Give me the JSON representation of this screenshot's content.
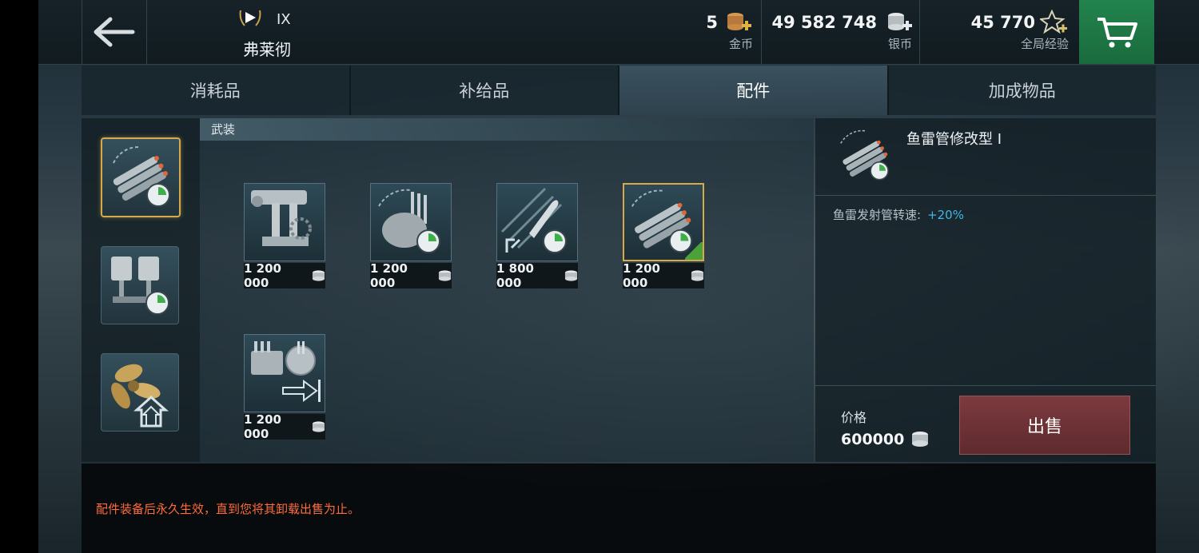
{
  "header": {
    "back_icon": "arrow-left-icon",
    "tier": "IX",
    "ship_name": "弗莱彻",
    "resources": [
      {
        "value": "5",
        "label": "金币",
        "icon": "gold-coins-icon"
      },
      {
        "value": "49 582 748",
        "label": "银币",
        "icon": "silver-coins-icon"
      },
      {
        "value": "45 770",
        "label": "全局经验",
        "icon": "star-xp-icon"
      }
    ],
    "cart_icon": "cart-icon"
  },
  "tabs": [
    {
      "label": "消耗品",
      "active": false
    },
    {
      "label": "补给品",
      "active": false
    },
    {
      "label": "配件",
      "active": true
    },
    {
      "label": "加成物品",
      "active": false
    }
  ],
  "categories": [
    {
      "name": "torpedo-category",
      "selected": true
    },
    {
      "name": "engine-category",
      "selected": false
    },
    {
      "name": "propeller-category",
      "selected": false
    }
  ],
  "section": {
    "title": "武装"
  },
  "items": [
    {
      "name": "main-battery-mod",
      "price": "1 200 000",
      "selected": false
    },
    {
      "name": "turret-rotation-mod",
      "price": "1 200 000",
      "selected": false
    },
    {
      "name": "gun-reload-mod",
      "price": "1 800 000",
      "selected": false
    },
    {
      "name": "torpedo-tube-mod",
      "price": "1 200 000",
      "selected": true
    },
    {
      "name": "secondary-battery-mod",
      "price": "1 200 000",
      "selected": false
    }
  ],
  "detail": {
    "name": "鱼雷管修改型 I",
    "stat_label": "鱼雷发射管转速:",
    "stat_bonus": "+20%",
    "price_label": "价格",
    "price_value": "600000",
    "sell_label": "出售"
  },
  "notice": "配件装备后永久生效，直到您将其卸载出售为止。",
  "colors": {
    "accent_gold": "#d6a94a",
    "cart_green": "#22834d",
    "sell_red": "#7c3a3e",
    "bonus_blue": "#3fb6e8",
    "notice_orange": "#ff6b3a"
  }
}
